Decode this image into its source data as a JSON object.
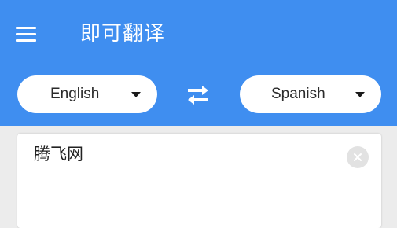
{
  "app": {
    "title": "即可翻译"
  },
  "icons": {
    "menu": "menu-icon",
    "swap": "swap-arrows-icon",
    "dropdown": "caret-down-icon",
    "clear": "close-icon"
  },
  "colors": {
    "header": "#3f8ef0",
    "background": "#ececec",
    "pill": "#ffffff",
    "clear_button": "#e2e2e2"
  },
  "languages": {
    "source": "English",
    "target": "Spanish"
  },
  "input": {
    "value": "腾飞网"
  }
}
